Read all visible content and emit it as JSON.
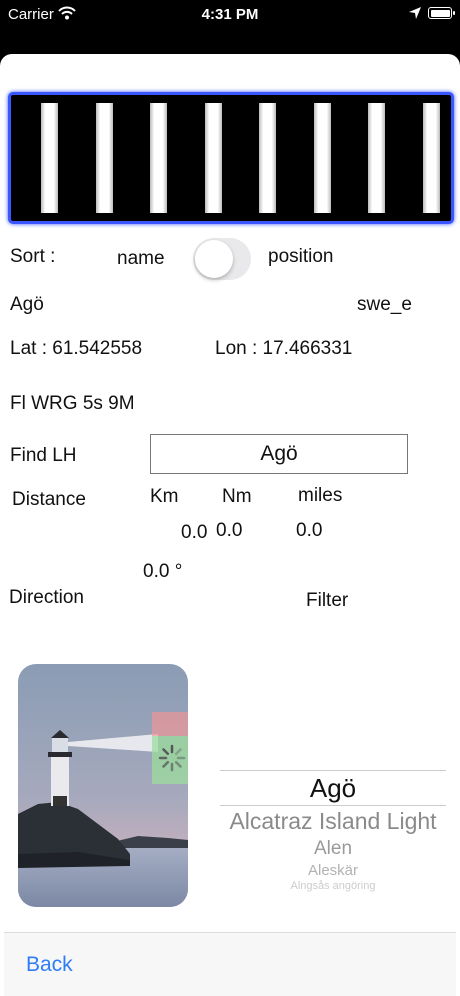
{
  "status_bar": {
    "carrier": "Carrier",
    "time": "4:31 PM"
  },
  "flash_preview": {
    "bar_count": 8,
    "border_color": "#3a57ff"
  },
  "sort": {
    "label": "Sort :",
    "option_left": "name",
    "option_right": "position",
    "toggle_on": false
  },
  "light": {
    "name": "Agö",
    "region": "swe_e",
    "lat": "Lat : 61.542558",
    "lon": "Lon : 17.466331",
    "characteristic": "Fl WRG 5s 9M"
  },
  "find": {
    "label": "Find LH",
    "value": "Agö"
  },
  "distance": {
    "label": "Distance",
    "units": {
      "km": "Km",
      "nm": "Nm",
      "miles": "miles"
    },
    "values": {
      "km": "0.0",
      "nm": "0.0",
      "miles": "0.0"
    }
  },
  "direction": {
    "label": "Direction",
    "value": "0.0 °"
  },
  "filter": {
    "label": "Filter"
  },
  "picker": {
    "selected": "Agö",
    "items_below": [
      "Alcatraz Island Light",
      "Alen",
      "Aleskär",
      "Alngsås angöring"
    ]
  },
  "back_label": "Back"
}
